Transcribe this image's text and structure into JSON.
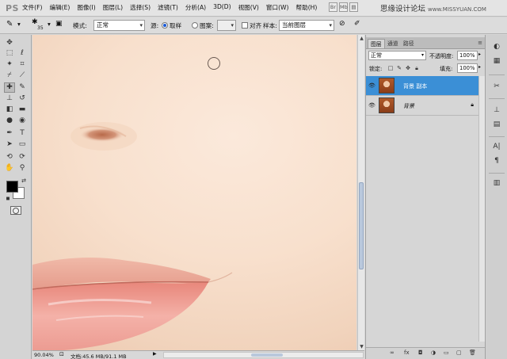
{
  "app": {
    "logo": "PS",
    "menu": [
      "文件(F)",
      "编辑(E)",
      "图像(I)",
      "图层(L)",
      "选择(S)",
      "滤镜(T)",
      "分析(A)",
      "3D(D)",
      "视图(V)",
      "窗口(W)",
      "帮助(H)"
    ],
    "watermark": "思缘设计论坛",
    "watermark_url": "www.MISSYUAN.COM"
  },
  "options": {
    "brush_size": "35",
    "mode_label": "模式:",
    "mode_value": "正常",
    "source_label": "源:",
    "source_sampled": "取样",
    "source_pattern": "图案:",
    "aligned_label": "对齐",
    "sample_label": "样本:",
    "sample_value": "当前图层"
  },
  "status": {
    "zoom": "90.04%",
    "doc": "文档:45.6 MB/91.1 MB"
  },
  "layers_panel": {
    "tabs": [
      "图层",
      "通道",
      "路径"
    ],
    "blend_mode": "正常",
    "opacity_label": "不透明度:",
    "opacity_value": "100%",
    "lock_label": "锁定:",
    "fill_label": "填充:",
    "fill_value": "100%",
    "layers": [
      {
        "name": "背景 副本",
        "selected": true,
        "locked": false
      },
      {
        "name": "背景",
        "selected": false,
        "locked": true
      }
    ]
  },
  "colors": {
    "selection": "#3b8fd6",
    "foreground": "#000000",
    "background": "#ffffff"
  }
}
